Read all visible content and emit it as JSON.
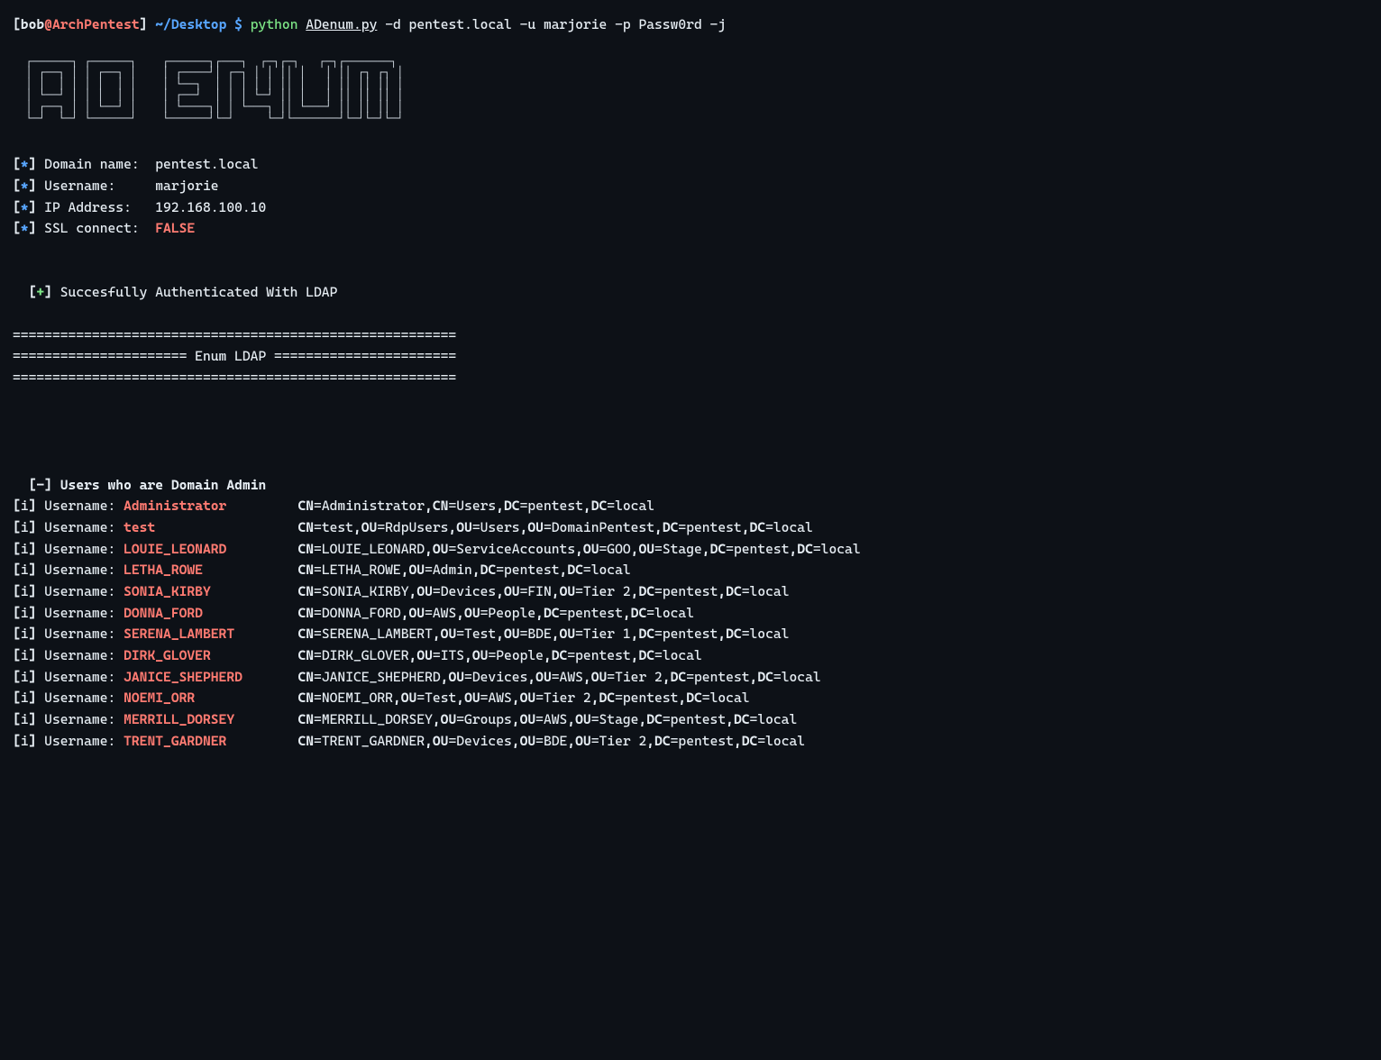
{
  "prompt": {
    "user": "bob",
    "at": "@",
    "host": "ArchPentest",
    "path": "~/Desktop",
    "dollar": "$",
    "py": "python",
    "script": "ADenum.py",
    "args": "-d pentest.local -u marjorie -p Passw0rd -j"
  },
  "banner": "  ┌──────┐ ┌──────┐    ┌──────┐┌───┐  ┌─┐┌─┐   ┌─┐┌───────┐\n  │ ┌──┐ │ │ ┌──┐ │    │ ┌────┘│ ┌─┐ │ │ ││ │   │ ││ ┌┐ ┌┐ │\n  │ │  │ │ │ │  │ │    │ └──┐  │ │ │ │ │ ││ │   │ ││ ││ ││ │\n  │ └──┘ │ │ │  │ │    │ ┌──┘  │ │ │ └─┘ ││ │   │ ││ ││ ││ │\n  │ ┌──┐ │ │ └──┘ │    │ └────┐│ │ └───┐ ││ └───┘ ││ ││ ││ │\n  └─┘  └─┘ └──────┘    └──────┘└─┘     └─┘└───────┘└─┘└─┘└─┘",
  "info": [
    {
      "sym": "*",
      "label": "Domain name:",
      "value": "pentest.local"
    },
    {
      "sym": "*",
      "label": "Username:   ",
      "value": "marjorie"
    },
    {
      "sym": "*",
      "label": "IP Address: ",
      "value": "192.168.100.10"
    },
    {
      "sym": "*",
      "label": "SSL connect:",
      "value": "FALSE",
      "red": true
    }
  ],
  "auth": {
    "sym": "+",
    "text": "Succesfully Authenticated With LDAP"
  },
  "section": {
    "rule": "========================================================",
    "mid": "====================== Enum LDAP ======================="
  },
  "users_header": {
    "sym": "-",
    "text": "Users who are Domain Admin"
  },
  "name_col": 36,
  "users": [
    {
      "u": "Administrator",
      "dn": [
        [
          "CN",
          "Administrator"
        ],
        [
          "CN",
          "Users"
        ],
        [
          "DC",
          "pentest"
        ],
        [
          "DC",
          "local"
        ]
      ]
    },
    {
      "u": "test",
      "dn": [
        [
          "CN",
          "test"
        ],
        [
          "OU",
          "RdpUsers"
        ],
        [
          "OU",
          "Users"
        ],
        [
          "OU",
          "DomainPentest"
        ],
        [
          "DC",
          "pentest"
        ],
        [
          "DC",
          "local"
        ]
      ]
    },
    {
      "u": "LOUIE_LEONARD",
      "dn": [
        [
          "CN",
          "LOUIE_LEONARD"
        ],
        [
          "OU",
          "ServiceAccounts"
        ],
        [
          "OU",
          "GOO"
        ],
        [
          "OU",
          "Stage"
        ],
        [
          "DC",
          "pentest"
        ],
        [
          "DC",
          "local"
        ]
      ]
    },
    {
      "u": "LETHA_ROWE",
      "dn": [
        [
          "CN",
          "LETHA_ROWE"
        ],
        [
          "OU",
          "Admin"
        ],
        [
          "DC",
          "pentest"
        ],
        [
          "DC",
          "local"
        ]
      ]
    },
    {
      "u": "SONIA_KIRBY",
      "dn": [
        [
          "CN",
          "SONIA_KIRBY"
        ],
        [
          "OU",
          "Devices"
        ],
        [
          "OU",
          "FIN"
        ],
        [
          "OU",
          "Tier 2"
        ],
        [
          "DC",
          "pentest"
        ],
        [
          "DC",
          "local"
        ]
      ]
    },
    {
      "u": "DONNA_FORD",
      "dn": [
        [
          "CN",
          "DONNA_FORD"
        ],
        [
          "OU",
          "AWS"
        ],
        [
          "OU",
          "People"
        ],
        [
          "DC",
          "pentest"
        ],
        [
          "DC",
          "local"
        ]
      ]
    },
    {
      "u": "SERENA_LAMBERT",
      "dn": [
        [
          "CN",
          "SERENA_LAMBERT"
        ],
        [
          "OU",
          "Test"
        ],
        [
          "OU",
          "BDE"
        ],
        [
          "OU",
          "Tier 1"
        ],
        [
          "DC",
          "pentest"
        ],
        [
          "DC",
          "local"
        ]
      ]
    },
    {
      "u": "DIRK_GLOVER",
      "dn": [
        [
          "CN",
          "DIRK_GLOVER"
        ],
        [
          "OU",
          "ITS"
        ],
        [
          "OU",
          "People"
        ],
        [
          "DC",
          "pentest"
        ],
        [
          "DC",
          "local"
        ]
      ]
    },
    {
      "u": "JANICE_SHEPHERD",
      "dn": [
        [
          "CN",
          "JANICE_SHEPHERD"
        ],
        [
          "OU",
          "Devices"
        ],
        [
          "OU",
          "AWS"
        ],
        [
          "OU",
          "Tier 2"
        ],
        [
          "DC",
          "pentest"
        ],
        [
          "DC",
          "local"
        ]
      ]
    },
    {
      "u": "NOEMI_ORR",
      "dn": [
        [
          "CN",
          "NOEMI_ORR"
        ],
        [
          "OU",
          "Test"
        ],
        [
          "OU",
          "AWS"
        ],
        [
          "OU",
          "Tier 2"
        ],
        [
          "DC",
          "pentest"
        ],
        [
          "DC",
          "local"
        ]
      ]
    },
    {
      "u": "MERRILL_DORSEY",
      "dn": [
        [
          "CN",
          "MERRILL_DORSEY"
        ],
        [
          "OU",
          "Groups"
        ],
        [
          "OU",
          "AWS"
        ],
        [
          "OU",
          "Stage"
        ],
        [
          "DC",
          "pentest"
        ],
        [
          "DC",
          "local"
        ]
      ]
    },
    {
      "u": "TRENT_GARDNER",
      "dn": [
        [
          "CN",
          "TRENT_GARDNER"
        ],
        [
          "OU",
          "Devices"
        ],
        [
          "OU",
          "BDE"
        ],
        [
          "OU",
          "Tier 2"
        ],
        [
          "DC",
          "pentest"
        ],
        [
          "DC",
          "local"
        ]
      ]
    }
  ]
}
